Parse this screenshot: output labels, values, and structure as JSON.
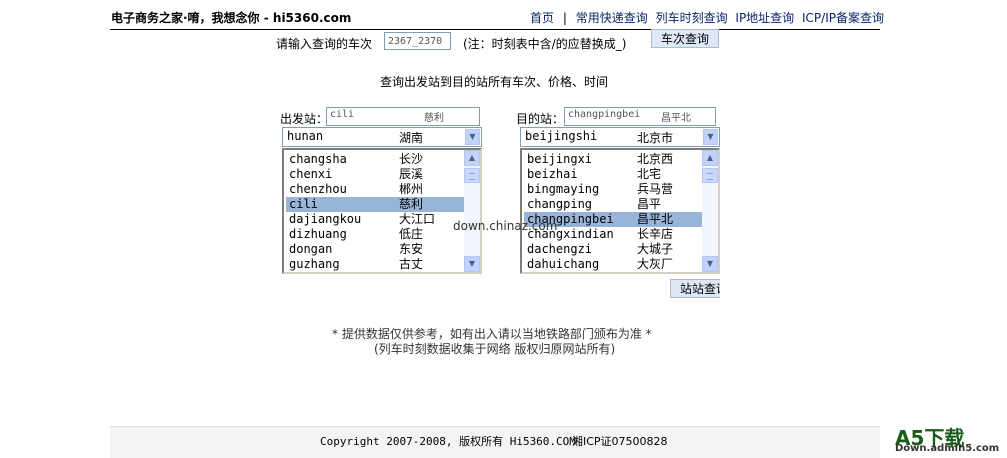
{
  "header": {
    "site_title": "电子商务之家·唷，我想念你 - hi5360.com",
    "nav": [
      {
        "label": "首页"
      },
      {
        "label": "常用快递查询"
      },
      {
        "label": "列车时刻查询"
      },
      {
        "label": "IP地址查询"
      },
      {
        "label": "ICP/IP备案查询"
      }
    ],
    "nav_separator": "|"
  },
  "train_query": {
    "label": "请输入查询的车次",
    "value": "2367_2370",
    "note": "(注：时刻表中含/的应替换成_)",
    "button": "车次查询"
  },
  "station_query": {
    "heading": "查询出发站到目的站所有车次、价格、时间",
    "from_label": "出发站：",
    "from_value_code": "cili",
    "from_value_name": "慈利",
    "to_label": "目的站：",
    "to_value_code": "changpingbei",
    "to_value_name": "昌平北",
    "from_province": {
      "code": "hunan",
      "name": "湖南"
    },
    "to_province": {
      "code": "beijingshi",
      "name": "北京市"
    },
    "from_list": [
      {
        "code": "changsha",
        "name": "长沙"
      },
      {
        "code": "chenxi",
        "name": "辰溪"
      },
      {
        "code": "chenzhou",
        "name": "郴州"
      },
      {
        "code": "cili",
        "name": "慈利",
        "selected": true
      },
      {
        "code": "dajiangkou",
        "name": "大江口"
      },
      {
        "code": "dizhuang",
        "name": "低庄"
      },
      {
        "code": "dongan",
        "name": "东安"
      },
      {
        "code": "guzhang",
        "name": "古丈"
      }
    ],
    "to_list": [
      {
        "code": "beijingxi",
        "name": "北京西"
      },
      {
        "code": "beizhai",
        "name": "北宅"
      },
      {
        "code": "bingmaying",
        "name": "兵马营"
      },
      {
        "code": "changping",
        "name": "昌平"
      },
      {
        "code": "changpingbei",
        "name": "昌平北",
        "selected": true
      },
      {
        "code": "changxindian",
        "name": "长辛店"
      },
      {
        "code": "dachengzi",
        "name": "大城子"
      },
      {
        "code": "dahuichang",
        "name": "大灰厂"
      }
    ],
    "button": "站站查询"
  },
  "watermark_center": "down.chinaz.com",
  "disclaimer": {
    "line1": "* 提供数据仅供参考，如有出入请以当地铁路部门颁布为准 *",
    "line2": "(列车时刻数据收集于网络 版权归原网站所有)"
  },
  "footer": {
    "copyright": "Copyright 2007-2008, 版权所有 Hi5360.COM",
    "icp": "湘ICP证07500828"
  },
  "corner_logo": {
    "main": "A5下载",
    "sub": "Down.admin5.com"
  }
}
